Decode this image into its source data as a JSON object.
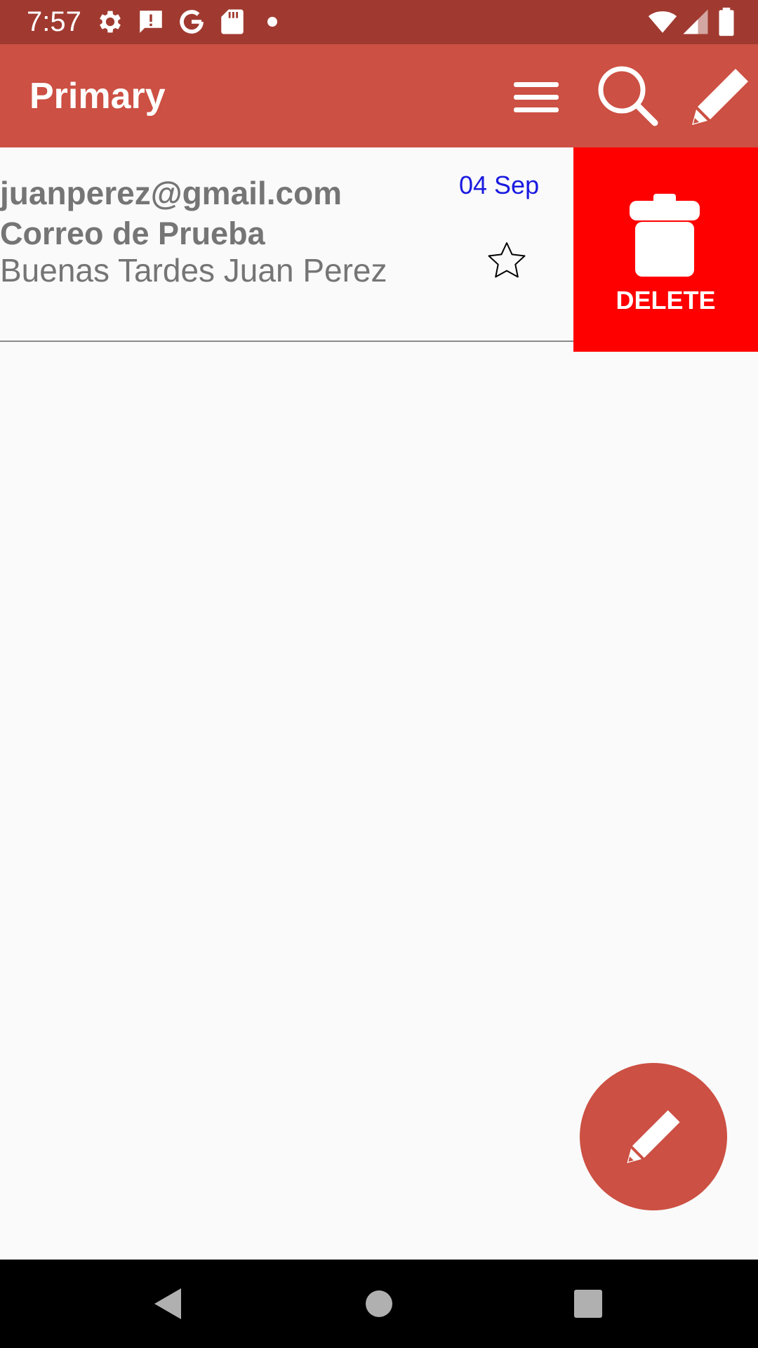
{
  "status_bar": {
    "time": "7:57",
    "left_icons": [
      "settings-icon",
      "alert-message-icon",
      "google-icon",
      "sd-card-icon",
      "dot-icon"
    ],
    "right_icons": [
      "wifi-icon",
      "cell-signal-icon",
      "battery-icon"
    ]
  },
  "app_bar": {
    "title": "Primary",
    "actions": [
      "menu-icon",
      "search-icon",
      "edit-icon"
    ]
  },
  "inbox": {
    "emails": [
      {
        "sender": "juanperez@gmail.com",
        "subject": "Correo de Prueba",
        "preview": "Buenas Tardes Juan Perez",
        "date": "04 Sep",
        "starred": false
      }
    ],
    "swipe_action": {
      "label": "DELETE",
      "icon": "trash-icon",
      "color": "#ff0000"
    }
  },
  "fab": {
    "icon": "edit-icon"
  },
  "nav_bar": {
    "buttons": [
      "back-icon",
      "home-icon",
      "recents-icon"
    ]
  },
  "colors": {
    "status_bar": "#a03a30",
    "app_bar": "#cc5043",
    "fab": "#cc5043",
    "date_text": "#1a1ae0",
    "delete_bg": "#ff0000",
    "body_text": "#757575"
  }
}
